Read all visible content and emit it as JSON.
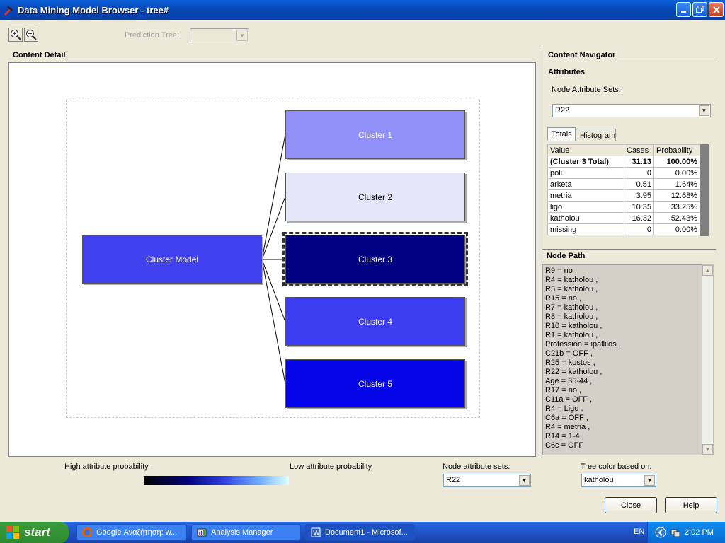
{
  "window": {
    "title": "Data Mining Model Browser - tree#"
  },
  "toolbar": {
    "prediction_tree_label": "Prediction Tree:",
    "prediction_tree_value": ""
  },
  "content_detail": {
    "header": "Content Detail"
  },
  "tree": {
    "root": {
      "label": "Cluster Model",
      "color": "#4040ee"
    },
    "children": [
      {
        "label": "Cluster 1",
        "color": "#9090f8"
      },
      {
        "label": "Cluster 2",
        "color": "#e6e6fb"
      },
      {
        "label": "Cluster 3",
        "color": "#000080"
      },
      {
        "label": "Cluster 4",
        "color": "#3c3cf0"
      },
      {
        "label": "Cluster 5",
        "color": "#0505e8"
      }
    ]
  },
  "navigator": {
    "header": "Content Navigator",
    "attributes_label": "Attributes",
    "node_attr_sets_label": "Node Attribute Sets:",
    "node_attr_sets_value": "R22",
    "tabs": [
      "Totals",
      "Histogram"
    ],
    "table": {
      "columns": [
        "Value",
        "Cases",
        "Probability"
      ],
      "rows": [
        {
          "value": "(Cluster 3 Total)",
          "cases": "31.13",
          "prob": "100.00%"
        },
        {
          "value": "poli",
          "cases": "0",
          "prob": "0.00%"
        },
        {
          "value": "arketa",
          "cases": "0.51",
          "prob": "1.64%"
        },
        {
          "value": "metria",
          "cases": "3.95",
          "prob": "12.68%"
        },
        {
          "value": "ligo",
          "cases": "10.35",
          "prob": "33.25%"
        },
        {
          "value": "katholou",
          "cases": "16.32",
          "prob": "52.43%"
        },
        {
          "value": "missing",
          "cases": "0",
          "prob": "0.00%"
        }
      ]
    },
    "node_path_label": "Node Path",
    "node_path": [
      "R9 = no ,",
      "R4 = katholou ,",
      "R5 = katholou ,",
      "R15 = no ,",
      "R7 = katholou ,",
      "R8 = katholou ,",
      "R10 = katholou ,",
      "R1 = katholou ,",
      "Profession = ipallilos ,",
      "C21b = OFF ,",
      "R25 = kostos ,",
      "R22 = katholou ,",
      "Age = 35-44 ,",
      "R17 = no ,",
      "C11a = OFF ,",
      "R4 = Ligo ,",
      "C6a = OFF ,",
      "R4 = metria ,",
      "R14 = 1-4 ,",
      "C6c = OFF"
    ]
  },
  "bottom": {
    "high_label": "High attribute probability",
    "low_label": "Low attribute probability",
    "node_attr_sets_label": "Node attribute sets:",
    "node_attr_sets_value": "R22",
    "tree_color_label": "Tree color based on:",
    "tree_color_value": "katholou",
    "close_label": "Close",
    "help_label": "Help"
  },
  "taskbar": {
    "start_label": "start",
    "tasks": [
      "Google Αναζήτηση: w...",
      "Analysis Manager",
      "Document1 - Microsof..."
    ],
    "lang": "EN",
    "clock": "2:02 PM"
  }
}
